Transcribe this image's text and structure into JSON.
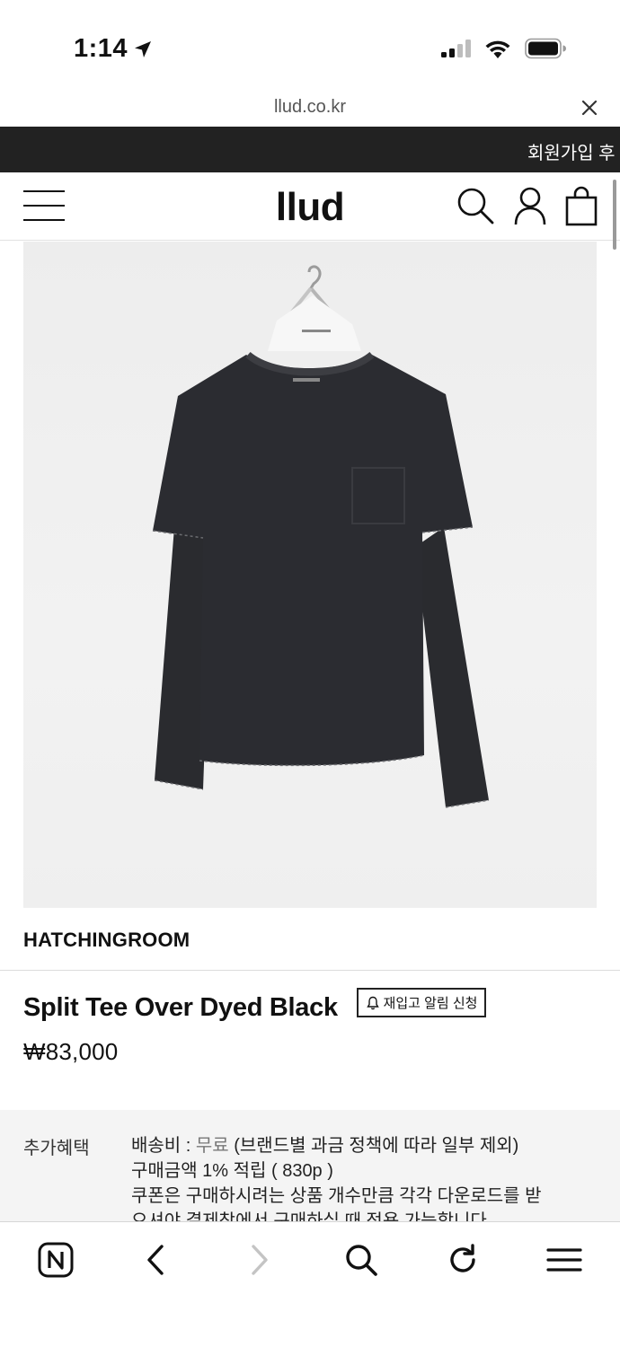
{
  "status_bar": {
    "time": "1:14",
    "icons": [
      "location-arrow-icon",
      "cellular-signal-icon",
      "wifi-icon",
      "battery-icon"
    ]
  },
  "browser": {
    "url": "llud.co.kr",
    "toolbar_icons": [
      "naver-home-icon",
      "back-icon",
      "forward-icon",
      "search-icon",
      "reload-icon",
      "menu-icon"
    ]
  },
  "banner": {
    "text": "회원가입 후"
  },
  "header": {
    "logo": "llud",
    "icons": [
      "hamburger-menu-icon",
      "search-icon",
      "account-icon",
      "shopping-bag-icon"
    ]
  },
  "product": {
    "brand": "HATCHINGROOM",
    "title": "Split Tee Over Dyed Black",
    "restock_button_label": "재입고 알림 신청",
    "price": "₩83,000"
  },
  "benefits": {
    "label": "추가혜택",
    "shipping_prefix": "배송비 : ",
    "shipping_free": "무료",
    "shipping_note": " (브랜드별 과금 정책에 따라 일부 제외)",
    "points": "구매금액 1% 적립 ( 830p )",
    "coupon_line1": "쿠폰은 구매하시려는 상품 개수만큼 각각 다운로드를 받",
    "coupon_line2": "으셔야 결제창에서 구매하실 때 적용 가능합니다."
  },
  "colors": {
    "banner_bg": "#222222",
    "benefits_bg": "#f4f4f4",
    "text": "#111111"
  }
}
